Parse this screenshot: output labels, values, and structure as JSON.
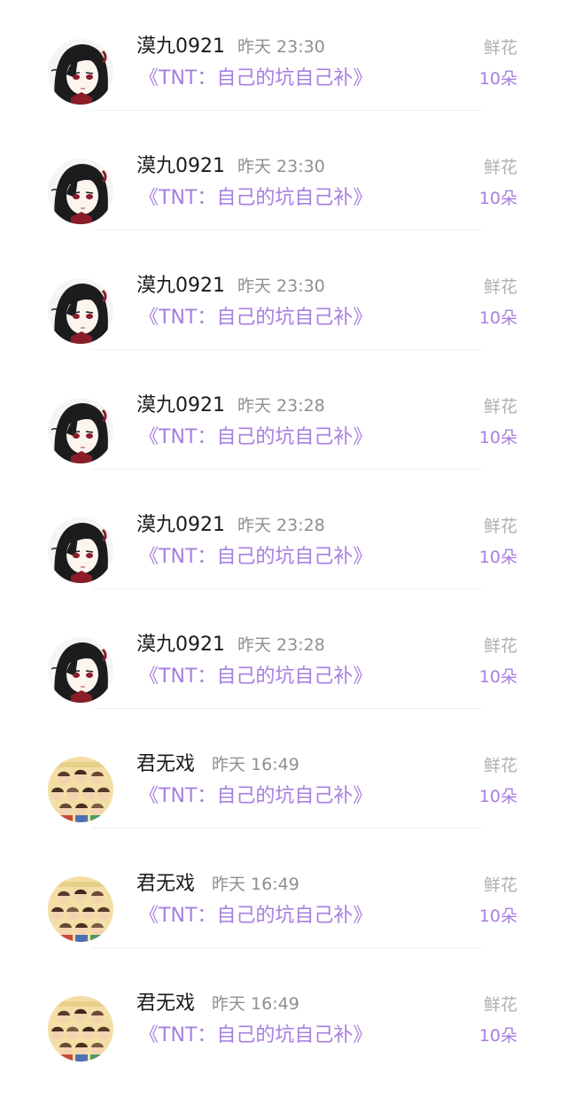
{
  "rows": [
    {
      "name": "漠九0921",
      "time": "昨天 23:30",
      "book": "《TNT：自己的坑自己补》",
      "gift_label": "鲜花",
      "gift_count": "10朵",
      "avatar": "ink-hair-character-icon"
    },
    {
      "name": "漠九0921",
      "time": "昨天 23:30",
      "book": "《TNT：自己的坑自己补》",
      "gift_label": "鲜花",
      "gift_count": "10朵",
      "avatar": "ink-hair-character-icon"
    },
    {
      "name": "漠九0921",
      "time": "昨天 23:30",
      "book": "《TNT：自己的坑自己补》",
      "gift_label": "鲜花",
      "gift_count": "10朵",
      "avatar": "ink-hair-character-icon"
    },
    {
      "name": "漠九0921",
      "time": "昨天 23:28",
      "book": "《TNT：自己的坑自己补》",
      "gift_label": "鲜花",
      "gift_count": "10朵",
      "avatar": "ink-hair-character-icon"
    },
    {
      "name": "漠九0921",
      "time": "昨天 23:28",
      "book": "《TNT：自己的坑自己补》",
      "gift_label": "鲜花",
      "gift_count": "10朵",
      "avatar": "ink-hair-character-icon"
    },
    {
      "name": "漠九0921",
      "time": "昨天 23:28",
      "book": "《TNT：自己的坑自己补》",
      "gift_label": "鲜花",
      "gift_count": "10朵",
      "avatar": "ink-hair-character-icon"
    },
    {
      "name": "君无戏",
      "time": "昨天 16:49",
      "book": "《TNT：自己的坑自己补》",
      "gift_label": "鲜花",
      "gift_count": "10朵",
      "avatar": "cartoon-group-icon"
    },
    {
      "name": "君无戏",
      "time": "昨天 16:49",
      "book": "《TNT：自己的坑自己补》",
      "gift_label": "鲜花",
      "gift_count": "10朵",
      "avatar": "cartoon-group-icon"
    },
    {
      "name": "君无戏",
      "time": "昨天 16:49",
      "book": "《TNT：自己的坑自己补》",
      "gift_label": "鲜花",
      "gift_count": "10朵",
      "avatar": "cartoon-group-icon"
    }
  ],
  "colors": {
    "name": "#1a1a1a",
    "time": "#8f8f8f",
    "accent": "#a77fe0",
    "gift_label": "#b0b0b0",
    "divider": "#f0f0f0"
  }
}
